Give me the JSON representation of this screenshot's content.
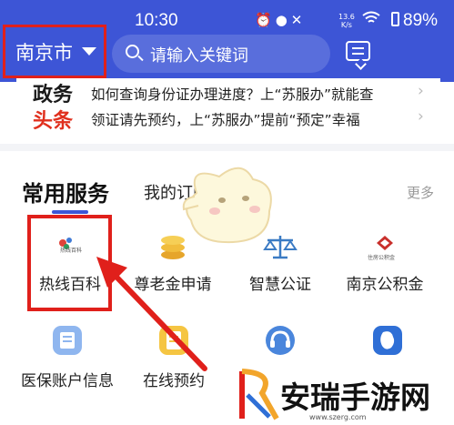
{
  "status_bar": {
    "time": "10:30",
    "network_speed_value": "13.6",
    "network_speed_unit": "K/s",
    "battery": "89%"
  },
  "header": {
    "city": "南京市",
    "search_placeholder": "请输入关键词"
  },
  "news": {
    "badge_line1": "政务",
    "badge_line2": "头条",
    "items": [
      "如何查询身份证办理进度？上“苏服办”就能查",
      "领证请先预约，上“苏服办”提前“预定”幸福"
    ]
  },
  "tabs": {
    "active": "常用服务",
    "second": "我的订阅",
    "more": "更多"
  },
  "services": [
    {
      "label": "热线百科",
      "icon": "hotline-encyclopedia-icon",
      "icon_text": "热线百科"
    },
    {
      "label": "尊老金申请",
      "icon": "coins-icon"
    },
    {
      "label": "智慧公证",
      "icon": "scales-icon"
    },
    {
      "label": "南京公积金",
      "icon": "housing-fund-icon",
      "icon_text": "住房公积金"
    },
    {
      "label": "医保账户信息",
      "icon": "medical-insurance-icon"
    },
    {
      "label": "在线预约",
      "icon": "appointment-icon"
    },
    {
      "label": "",
      "icon": "headset-icon"
    },
    {
      "label": "",
      "icon": "map-icon"
    }
  ],
  "watermark": {
    "text": "安瑞手游网",
    "url": "www.szerg.com"
  },
  "colors": {
    "brand_blue": "#3d55d6",
    "highlight_red": "#e0201b",
    "news_red": "#e0301e"
  }
}
